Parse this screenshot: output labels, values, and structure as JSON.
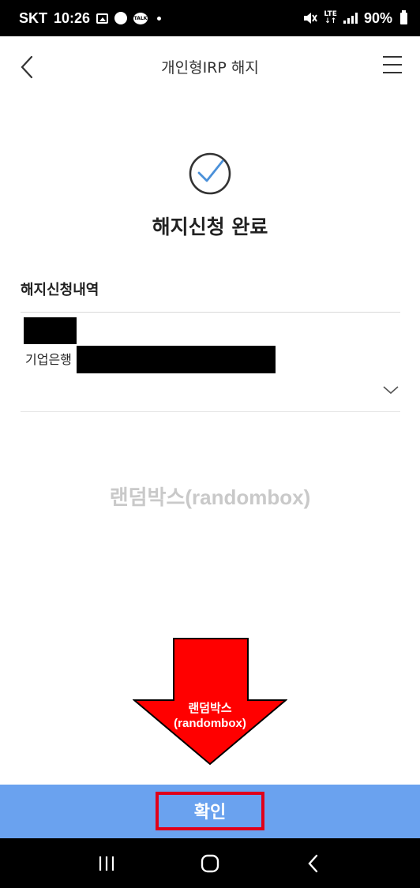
{
  "status_bar": {
    "carrier": "SKT",
    "time": "10:26",
    "talk_badge": "TALK",
    "lte_top": "LTE",
    "lte_bottom": "↓↑",
    "battery": "90%"
  },
  "header": {
    "title": "개인형IRP 해지"
  },
  "result": {
    "title": "해지신청 완료"
  },
  "details": {
    "section_title": "해지신청내역",
    "bank_name": "기업은행"
  },
  "watermark": "랜덤박스(randombox)",
  "annotation": {
    "line1": "랜덤박스",
    "line2": "(randombox)"
  },
  "confirm": {
    "label": "확인"
  },
  "colors": {
    "confirm_bg": "#6aa2ef",
    "highlight_border": "#e0001a",
    "arrow_fill": "#ff0000",
    "check_stroke": "#4a90d9"
  }
}
